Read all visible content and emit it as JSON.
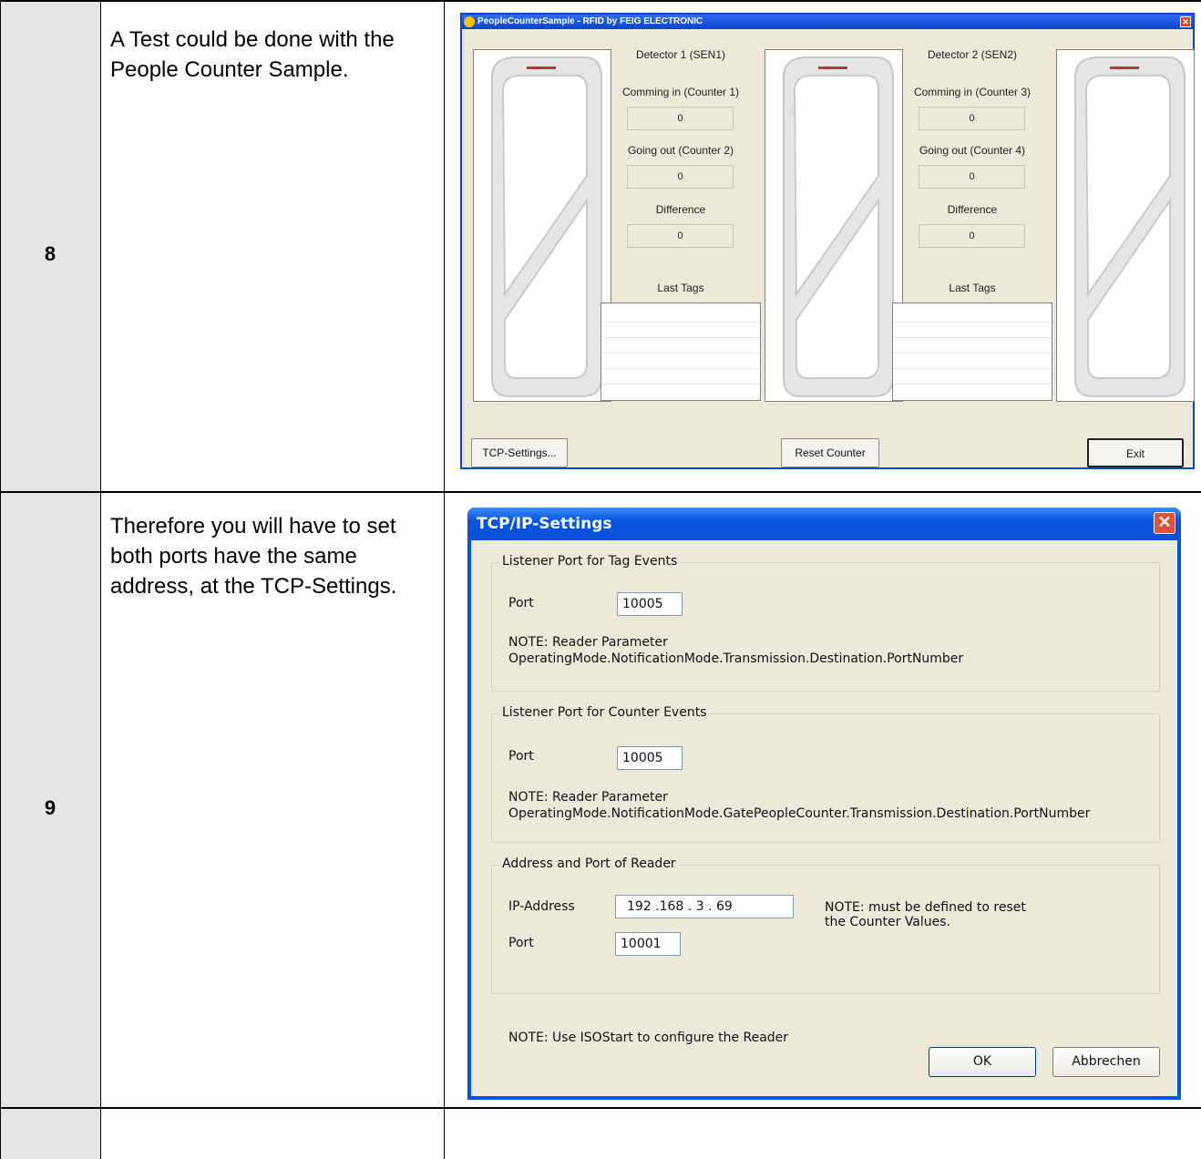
{
  "rows": [
    {
      "number": "8",
      "description": "A Test could be done with the People Counter Sample."
    },
    {
      "number": "9",
      "description": "Therefore you will have to set both ports have the same address, at the TCP-Settings."
    }
  ],
  "people_counter": {
    "title": "PeopleCounterSample - RFID by FEIG ELECTRONIC",
    "detectors": [
      {
        "title": "Detector 1 (SEN1)",
        "in_label": "Comming in (Counter 1)",
        "in_value": "0",
        "out_label": "Going out (Counter 2)",
        "out_value": "0",
        "diff_label": "Difference",
        "diff_value": "0",
        "last_tags_label": "Last Tags"
      },
      {
        "title": "Detector 2 (SEN2)",
        "in_label": "Comming in (Counter 3)",
        "in_value": "0",
        "out_label": "Going out (Counter 4)",
        "out_value": "0",
        "diff_label": "Difference",
        "diff_value": "0",
        "last_tags_label": "Last Tags"
      }
    ],
    "buttons": {
      "tcp_settings": "TCP-Settings...",
      "reset_counter": "Reset Counter",
      "exit": "Exit"
    }
  },
  "tcp_dialog": {
    "title": "TCP/IP-Settings",
    "close_glyph": "✕",
    "groups": {
      "tag_events": {
        "legend": "Listener Port for Tag Events",
        "port_label": "Port",
        "port_value": "10005",
        "note_line1": "NOTE: Reader Parameter",
        "note_line2": "OperatingMode.NotificationMode.Transmission.Destination.PortNumber"
      },
      "counter_events": {
        "legend": "Listener Port for Counter Events",
        "port_label": "Port",
        "port_value": "10005",
        "note_line1": "NOTE: Reader Parameter",
        "note_line2": "OperatingMode.NotificationMode.GatePeopleCounter.Transmission.Destination.PortNumber"
      },
      "reader": {
        "legend": "Address and Port of Reader",
        "ip_label": "IP-Address",
        "ip_value": "192 .168 . 3 . 69",
        "note_line1": "NOTE: must be defined to reset",
        "note_line2": "the Counter Values.",
        "port_label": "Port",
        "port_value": "10001"
      }
    },
    "footer_note": "NOTE: Use ISOStart to configure the Reader",
    "ok_label": "OK",
    "cancel_label": "Abbrechen"
  }
}
